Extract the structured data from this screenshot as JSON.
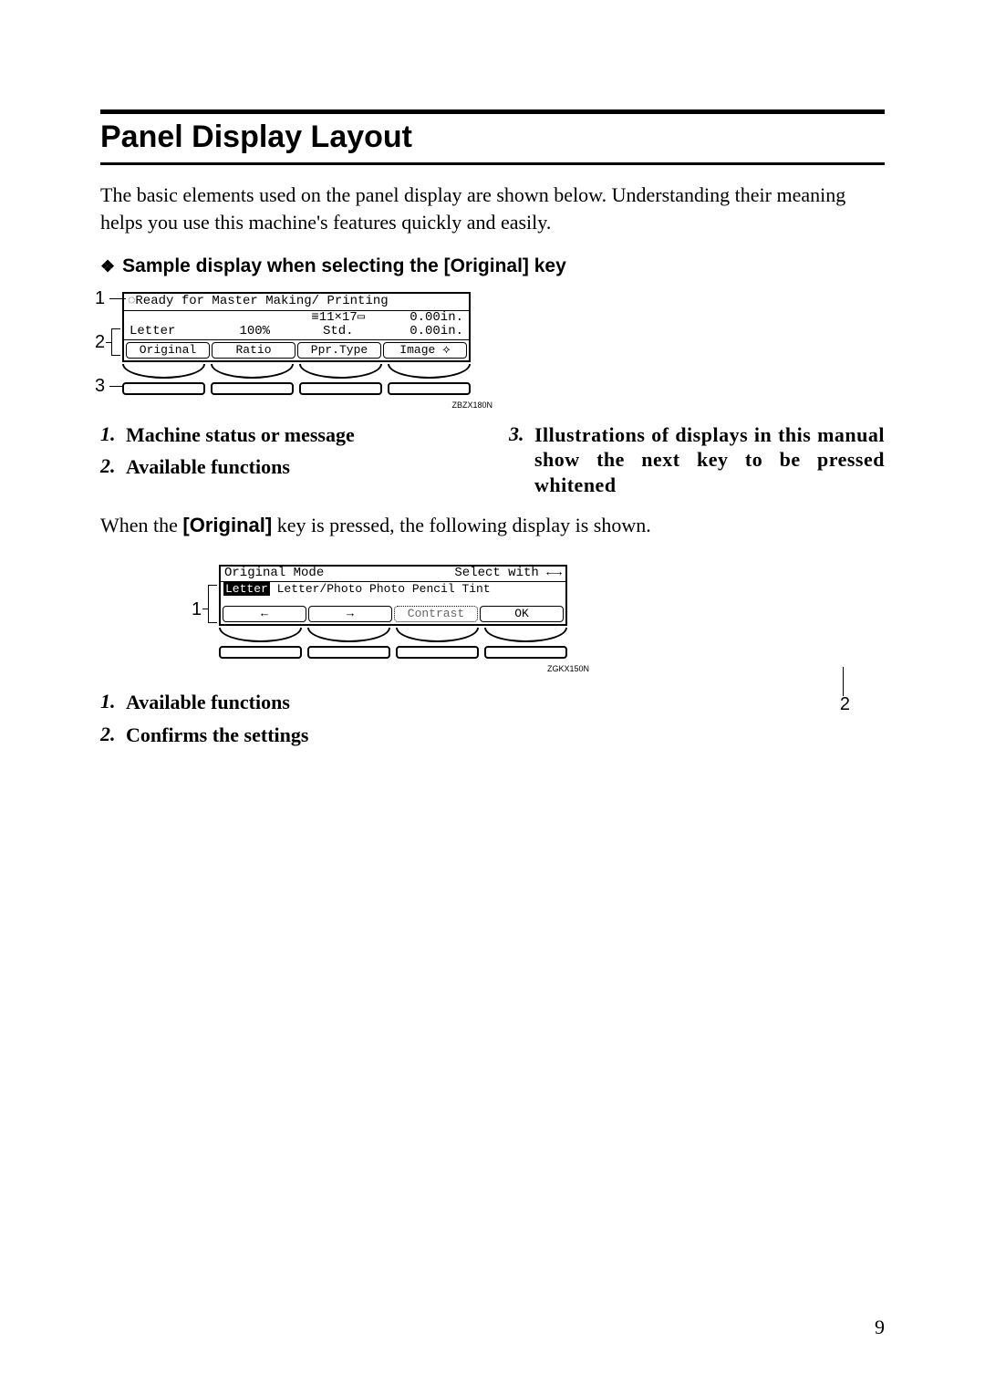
{
  "title": "Panel Display Layout",
  "intro": "The basic elements used on the panel display are shown below. Understanding their meaning helps you use this machine's features quickly and easily.",
  "subheading": "Sample display when selecting the [Original] key",
  "fig1": {
    "status": "Ready for Master Making/ Printing",
    "infoRow1": {
      "c1": "",
      "c2": "",
      "c3": "≡11×17▭",
      "c4": "0.00in."
    },
    "infoRow2": {
      "c1": "Letter",
      "c2": "100%",
      "c3": "Std.",
      "c4": "0.00in."
    },
    "buttons": {
      "b1": "Original",
      "b2": "Ratio",
      "b3": "Ppr.Type",
      "b4": "Image ⟡"
    },
    "code": "ZBZX180N"
  },
  "list1": {
    "i1": "Machine status or message",
    "i2": "Available functions",
    "i3": "Illustrations of displays in this manual show the next key to be pressed whitened"
  },
  "midtext_a": "When the ",
  "midtext_key": "[Original]",
  "midtext_b": " key is pressed, the following display is shown.",
  "fig2": {
    "titleLeft": "Original Mode",
    "titleRight": "Select with ←→",
    "options": {
      "sel": "Letter",
      "rest": " Letter/Photo Photo Pencil Tint"
    },
    "buttons": {
      "b1": "←",
      "b2": "→",
      "b3": "Contrast",
      "b4": "OK"
    },
    "code": "ZGKX150N"
  },
  "list2": {
    "i1": "Available functions",
    "i2": "Confirms the settings"
  },
  "pageNumber": "9"
}
